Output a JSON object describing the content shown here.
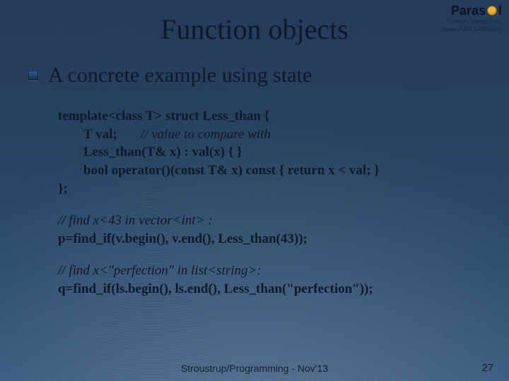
{
  "title": "Function objects",
  "logo": {
    "brand_prefix": "Paras",
    "brand_suffix": "l",
    "tagline": "Smarter computing.",
    "university": "Texas A&M University"
  },
  "subheading": "A concrete example using state",
  "code": {
    "l1": "template<class T> struct Less_than {",
    "l2a": "T val;",
    "l2b": "// value to compare with",
    "l3": "Less_than(T& x) : val(x) { }",
    "l4": "bool operator()(const T& x) const { return x < val; }",
    "l5": "};",
    "c1": "// find x<43 in vector<int> :",
    "p1": "p=find_if(v.begin(), v.end(), Less_than(43));",
    "c2": "// find x<\"perfection\" in list<string>:",
    "p2": "q=find_if(ls.begin(), ls.end(), Less_than(\"perfection\"));"
  },
  "footer": "Stroustrup/Programming - Nov'13",
  "page_number": "27"
}
